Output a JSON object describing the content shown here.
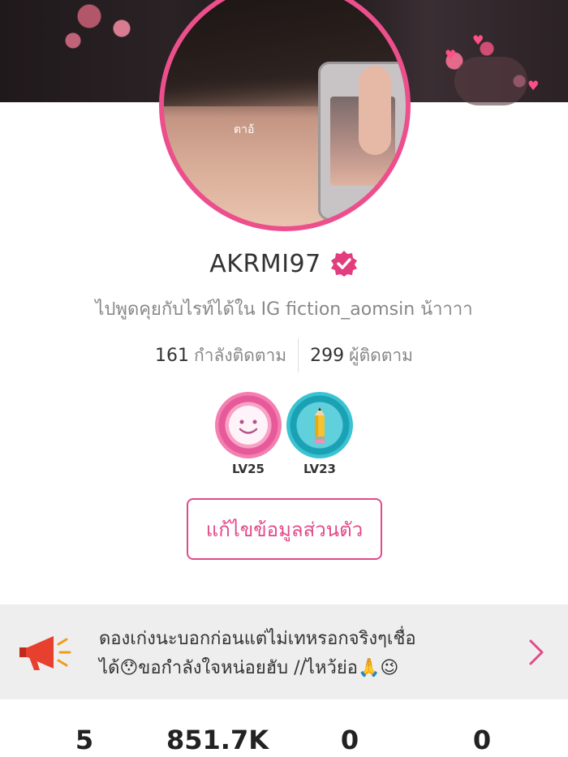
{
  "profile": {
    "username": "AKRMI97",
    "bio": "ไปพูดคุยกับไรท์ได้ใน IG  fiction_aomsin น้าาาา",
    "avatar_sticker": "ตาอ้",
    "following_count": "161",
    "following_label": "กำลังติดตาม",
    "followers_count": "299",
    "followers_label": "ผู้ติดตาม"
  },
  "badges": [
    {
      "level": "LV25",
      "icon": "smiley-face-icon",
      "color": "#e65a9a"
    },
    {
      "level": "LV23",
      "icon": "pencil-icon",
      "color": "#1aa1b4"
    }
  ],
  "edit_button_label": "แก้ไขข้อมูลส่วนตัว",
  "announcement": {
    "line1": "ดองเก่งนะบอกก่อนแต่ไม่เทหรอกจริงๆเชื่อ",
    "line2": "ได้😯ขอกำลังใจหน่อยฮับ //ไหว้ย่อ🙏😉",
    "icon": "megaphone-icon"
  },
  "counts": [
    "5",
    "851.7K",
    "0",
    "0"
  ],
  "colors": {
    "accent": "#e14a8a",
    "ring": "#ec4f8c",
    "announce_bg": "#eeeeee"
  }
}
